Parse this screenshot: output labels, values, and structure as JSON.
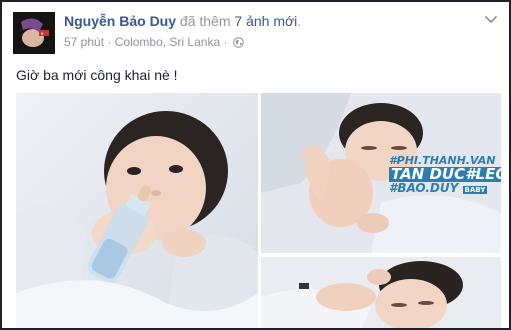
{
  "post": {
    "author": "Nguyễn Bảo Duy",
    "action_text": "đã thêm",
    "action_link": "7 ảnh mới",
    "action_suffix": ".",
    "time": "57 phút",
    "separator": "·",
    "location": "Colombo, Sri Lanka",
    "separator2": "·",
    "privacy_icon": "globe-icon",
    "menu_icon": "chevron-down-icon",
    "text": "Giờ ba mới công khai nè !"
  },
  "watermark": {
    "line1": "#PHI.THANH.VAN",
    "line2": "TAN DUC#LEO",
    "line3": "#BAO.DUY",
    "line3_badge": "BABY"
  },
  "colors": {
    "author": "#365899",
    "meta": "#90949c",
    "text": "#1d2129",
    "border": "#1d2129",
    "watermark": "#2b7fb0"
  }
}
